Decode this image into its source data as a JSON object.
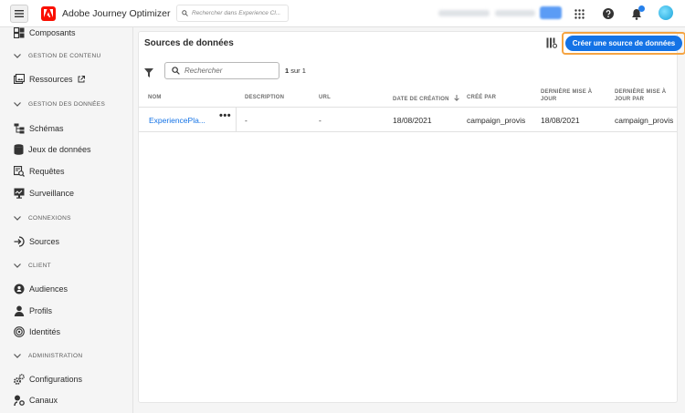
{
  "topbar": {
    "app_title": "Adobe Journey Optimizer",
    "search_placeholder": "Rechercher dans Experience Cl..."
  },
  "sidebar": {
    "items": [
      {
        "label": "Composants",
        "icon": "components-icon"
      },
      {
        "section": "GESTION DE CONTENU"
      },
      {
        "label": "Ressources",
        "icon": "assets-icon",
        "external": true
      },
      {
        "section": "GESTION DES DONNÉES"
      },
      {
        "label": "Schémas",
        "icon": "schema-icon"
      },
      {
        "label": "Jeux de données",
        "icon": "database-icon"
      },
      {
        "label": "Requêtes",
        "icon": "queries-icon"
      },
      {
        "label": "Surveillance",
        "icon": "monitoring-icon"
      },
      {
        "section": "CONNEXIONS"
      },
      {
        "label": "Sources",
        "icon": "sources-icon"
      },
      {
        "section": "CLIENT"
      },
      {
        "label": "Audiences",
        "icon": "audiences-icon"
      },
      {
        "label": "Profils",
        "icon": "profile-icon"
      },
      {
        "label": "Identités",
        "icon": "identity-icon"
      },
      {
        "section": "ADMINISTRATION"
      },
      {
        "label": "Configurations",
        "icon": "gears-icon"
      },
      {
        "label": "Canaux",
        "icon": "channels-icon"
      }
    ]
  },
  "main": {
    "title": "Sources de données",
    "create_button": "Créer une source de données",
    "search_placeholder": "Rechercher",
    "count": {
      "current": "1",
      "rest": "sur 1"
    },
    "columns": [
      "NOM",
      "DESCRIPTION",
      "URL",
      "DATE DE CRÉATION",
      "CRÉÉ PAR",
      "DERNIÈRE MISE À JOUR",
      "DERNIÈRE MISE À JOUR PAR"
    ],
    "rows": [
      {
        "name": "ExperiencePla...",
        "description": "-",
        "url": "-",
        "created": "18/08/2021",
        "created_by": "campaign_provis",
        "updated": "18/08/2021",
        "updated_by": "campaign_provis"
      }
    ]
  },
  "colors": {
    "accent": "#1473e6",
    "highlight": "#f5a442",
    "brand": "#fa0f00"
  }
}
